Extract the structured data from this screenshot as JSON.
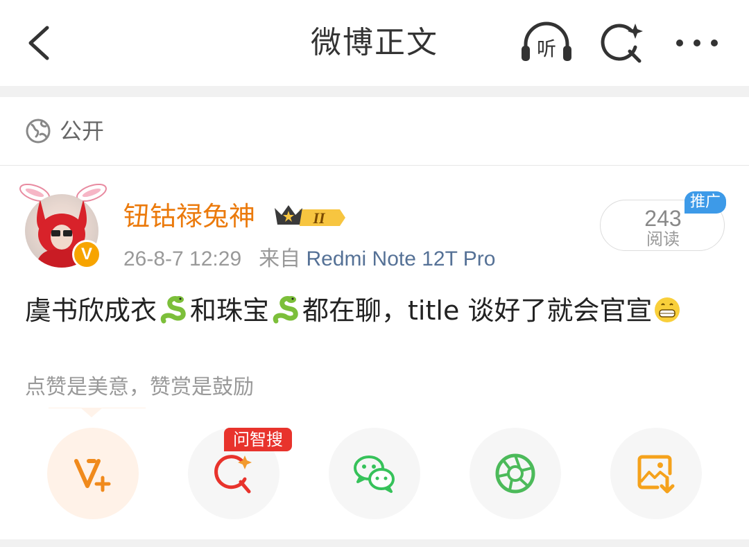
{
  "header": {
    "title": "微博正文",
    "back_icon": "chevron-left-icon",
    "listen_icon": "headphones-listen-icon",
    "listen_label": "听",
    "ai_search_icon": "sparkle-search-icon",
    "more_icon": "more-dots-icon"
  },
  "visibility": {
    "icon": "globe-icon",
    "label": "公开"
  },
  "post": {
    "author": "钮钴禄兔神",
    "member_level": "II",
    "timestamp": "26-8-7 12:29",
    "source_prefix": "来自",
    "source": "Redmi Note 12T Pro",
    "verified_mark": "V",
    "read_count": "243",
    "read_label": "阅读",
    "promo_label": "推广",
    "text_parts": [
      "虞书欣成衣",
      "和珠宝",
      "都在聊，title 谈好了就会官宣"
    ]
  },
  "encourage_text": "点赞是美意，赞赏是鼓励",
  "actions": [
    {
      "name": "vplus",
      "icon": "v-plus-icon"
    },
    {
      "name": "ask-search",
      "icon": "ai-search-icon",
      "badge": "问智搜"
    },
    {
      "name": "wechat",
      "icon": "wechat-icon"
    },
    {
      "name": "moments",
      "icon": "moments-icon"
    },
    {
      "name": "save-image",
      "icon": "save-image-icon"
    }
  ],
  "colors": {
    "username": "#eb7a0c",
    "source_link": "#557196",
    "promo": "#3d9ae8",
    "ask_badge": "#e8332c",
    "wechat": "#36c25a",
    "moments": "#4cba5a",
    "accent_orange": "#f08a1c"
  }
}
